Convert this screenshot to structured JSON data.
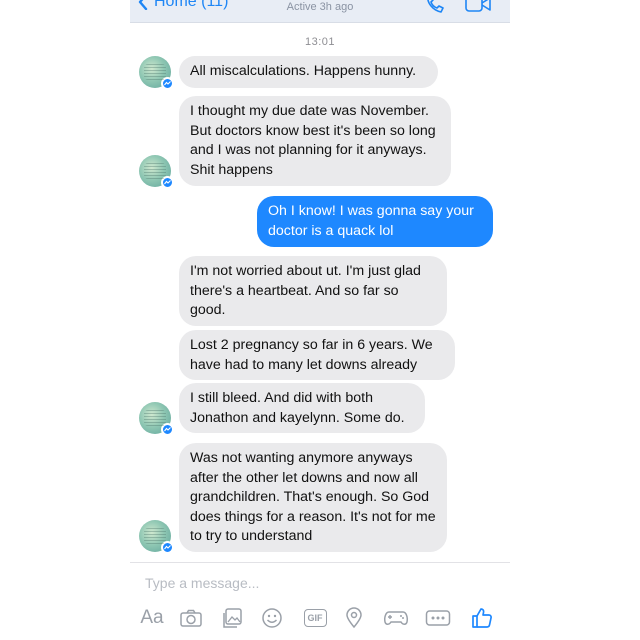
{
  "header": {
    "back_label": "Home (11)",
    "status": "Active 3h ago"
  },
  "conversation": {
    "timestamp": "13:01",
    "messages": [
      {
        "side": "in",
        "text": "All miscalculations. Happens hunny."
      },
      {
        "side": "in",
        "text": "I thought my due date was November. But doctors know best it's been so long and I was not planning for it anyways. Shit happens"
      },
      {
        "side": "out",
        "text": "Oh I know! I was gonna say your doctor is a quack lol"
      },
      {
        "side": "in",
        "text": "I'm not worried about ut. I'm just glad there's a heartbeat.  And so far so good."
      },
      {
        "side": "in",
        "text": "Lost 2 pregnancy so far in 6 years. We have had to many let downs already"
      },
      {
        "side": "in",
        "text": "I still bleed. And did with both Jonathon and kayelynn. Some do."
      },
      {
        "side": "in",
        "text": "Was not wanting anymore anyways after the other let downs and now all grandchildren. That's enough. So God does things for a reason. It's not for me to try to understand"
      }
    ]
  },
  "composer": {
    "placeholder": "Type a message...",
    "aa_label": "Aa",
    "gif_label": "GIF",
    "tools": [
      "text-format-icon",
      "camera-icon",
      "gallery-icon",
      "emoji-icon",
      "gif-icon",
      "location-icon",
      "game-controller-icon",
      "more-icon",
      "thumbs-up-icon"
    ]
  },
  "colors": {
    "accent": "#1e88ff",
    "incoming_bubble": "#eaeaec",
    "topbar": "#e8edf5"
  }
}
